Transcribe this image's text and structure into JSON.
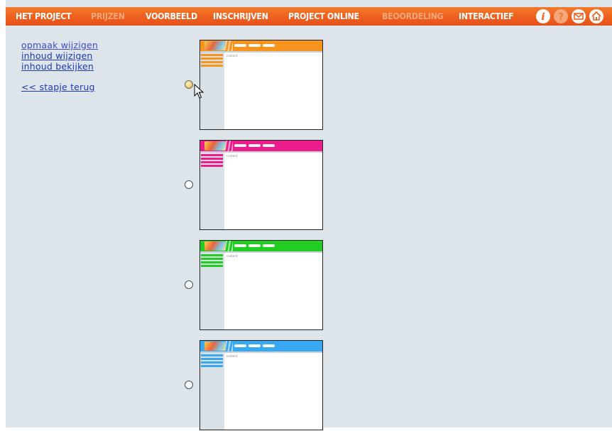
{
  "nav": {
    "items": [
      {
        "label": "HET PROJECT",
        "enabled": true
      },
      {
        "label": "PRIJZEN",
        "enabled": false
      },
      {
        "label": "VOORBEELD",
        "enabled": true
      },
      {
        "label": "INSCHRIJVEN",
        "enabled": true
      },
      {
        "label": "PROJECT ONLINE",
        "enabled": true
      },
      {
        "label": "BEOORDELING",
        "enabled": false
      },
      {
        "label": "INTERACTIEF",
        "enabled": true
      }
    ],
    "icons": [
      "info-icon",
      "help-icon",
      "mail-icon",
      "home-icon"
    ]
  },
  "left_links": {
    "edit_layout": "opmaak wijzigen",
    "edit_content": "inhoud wijzigen",
    "view_content": "inhoud bekijken",
    "back": "<< stapje terug"
  },
  "themes": [
    {
      "color": "#f7941d",
      "selected": true,
      "content_label": "content"
    },
    {
      "color": "#ec1c8c",
      "selected": false,
      "content_label": "content"
    },
    {
      "color": "#22cc22",
      "selected": false,
      "content_label": "content"
    },
    {
      "color": "#3aa8f0",
      "selected": false,
      "content_label": "content"
    }
  ]
}
